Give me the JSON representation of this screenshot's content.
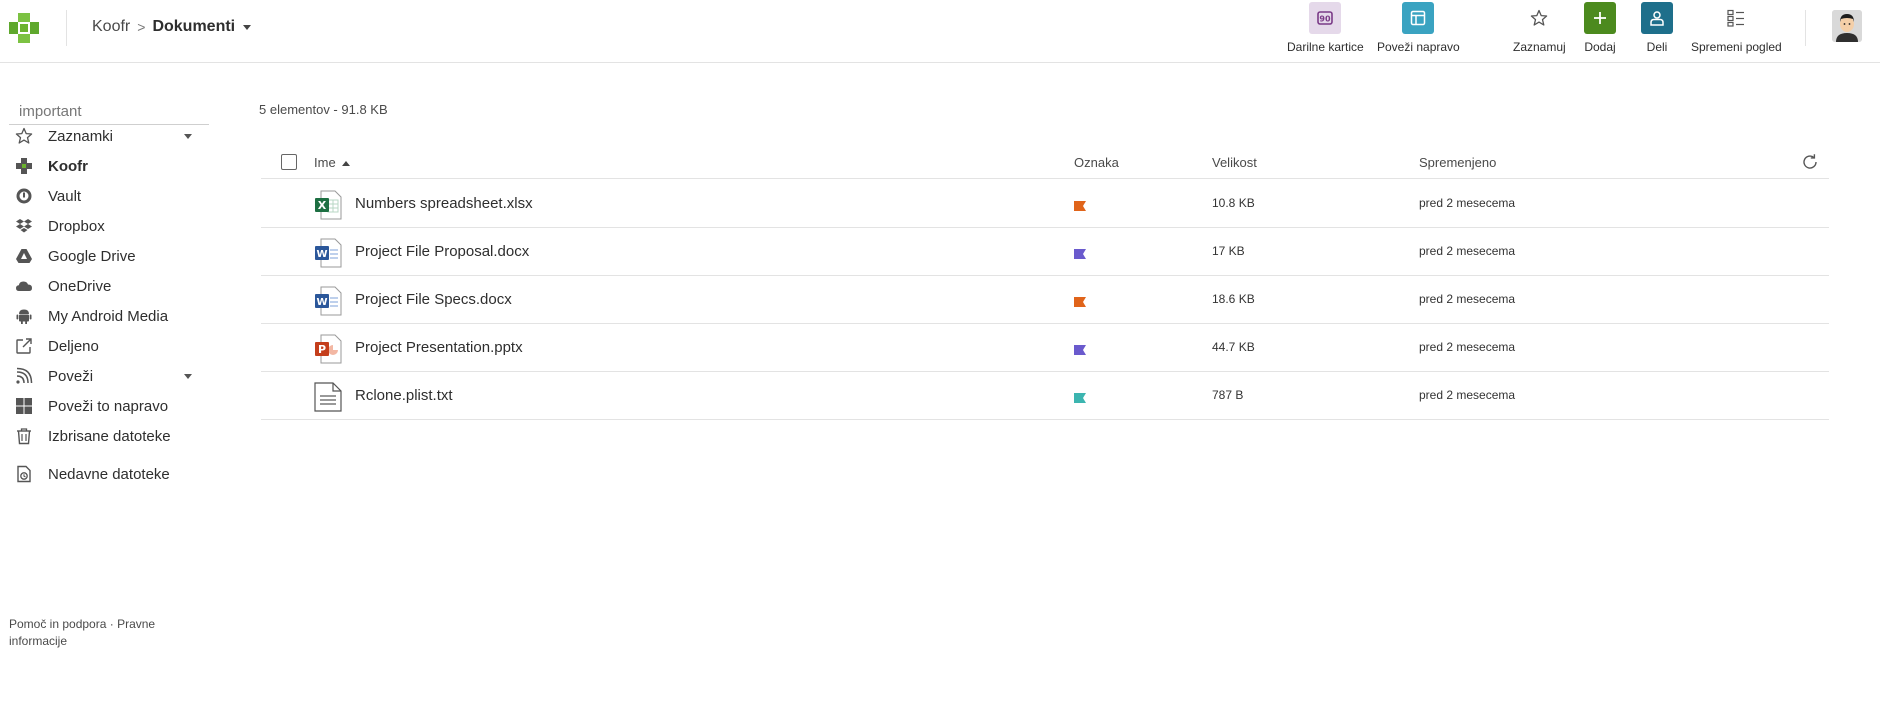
{
  "breadcrumb": {
    "root": "Koofr",
    "separator": ">",
    "current": "Dokumenti"
  },
  "toolbar": {
    "gift_cards": "Darilne kartice",
    "connect_device": "Poveži napravo",
    "bookmark": "Zaznamuj",
    "add": "Dodaj",
    "share": "Deli",
    "change_view": "Spremeni pogled"
  },
  "colors": {
    "brand_green": "#6bb32e",
    "add_green": "#4c8a1e",
    "share_teal": "#1e6f8b",
    "connect_blue": "#3aa3c1",
    "gift_purple": "#e5d9ea"
  },
  "sidebar": {
    "search_placeholder": "important",
    "items": [
      {
        "label": "Zaznamki",
        "icon": "star-icon"
      },
      {
        "label": "Koofr",
        "icon": "koofr-icon"
      },
      {
        "label": "Vault",
        "icon": "vault-icon"
      },
      {
        "label": "Dropbox",
        "icon": "dropbox-icon"
      },
      {
        "label": "Google Drive",
        "icon": "google-drive-icon"
      },
      {
        "label": "OneDrive",
        "icon": "cloud-icon"
      },
      {
        "label": "My Android Media",
        "icon": "android-icon"
      },
      {
        "label": "Deljeno",
        "icon": "share-external-icon"
      },
      {
        "label": "Poveži",
        "icon": "rss-icon"
      },
      {
        "label": "Poveži to napravo",
        "icon": "windows-icon"
      },
      {
        "label": "Izbrisane datoteke",
        "icon": "trash-icon"
      },
      {
        "label": "Nedavne datoteke",
        "icon": "recent-files-icon"
      }
    ],
    "footer": {
      "help": "Pomoč in podpora",
      "dot": " · ",
      "legal": "Pravne informacije"
    }
  },
  "main": {
    "summary": "5 elementov - 91.8 KB",
    "columns": {
      "name": "Ime",
      "tag": "Oznaka",
      "size": "Velikost",
      "modified": "Spremenjeno"
    },
    "files": [
      {
        "name": "Numbers spreadsheet.xlsx",
        "type": "xlsx",
        "tag_color": "#e0641a",
        "size": "10.8 KB",
        "modified": "pred 2 mesecema"
      },
      {
        "name": "Project File Proposal.docx",
        "type": "docx",
        "tag_color": "#6a5acd",
        "size": "17 KB",
        "modified": "pred 2 mesecema"
      },
      {
        "name": "Project File Specs.docx",
        "type": "docx",
        "tag_color": "#e0641a",
        "size": "18.6 KB",
        "modified": "pred 2 mesecema"
      },
      {
        "name": "Project Presentation.pptx",
        "type": "pptx",
        "tag_color": "#6a5acd",
        "size": "44.7 KB",
        "modified": "pred 2 mesecema"
      },
      {
        "name": "Rclone.plist.txt",
        "type": "txt",
        "tag_color": "#3cb5b0",
        "size": "787 B",
        "modified": "pred 2 mesecema"
      }
    ]
  }
}
